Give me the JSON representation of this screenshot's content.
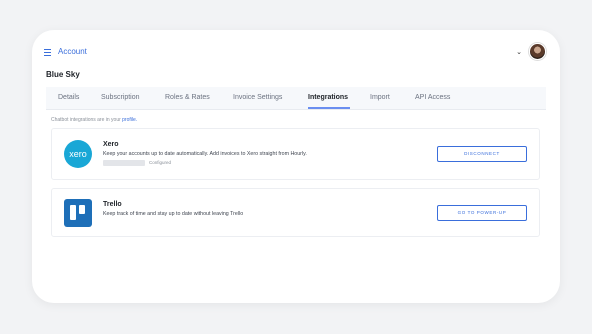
{
  "header": {
    "section_title": "Account",
    "company_name": "Blue Sky"
  },
  "tabs": [
    {
      "label": "Details"
    },
    {
      "label": "Subscription"
    },
    {
      "label": "Roles & Rates"
    },
    {
      "label": "Invoice Settings"
    },
    {
      "label": "Integrations",
      "active": true
    },
    {
      "label": "Import"
    },
    {
      "label": "API Access"
    }
  ],
  "note": {
    "prefix": "Chatbot integrations are in your",
    "link": "profile."
  },
  "integrations": [
    {
      "name": "Xero",
      "logo_text": "xero",
      "description": "Keep your accounts up to date automatically. Add invoices to Xero straight from Hourly.",
      "status": "Configured",
      "button_label": "DISCONNECT"
    },
    {
      "name": "Trello",
      "description": "Keep track of time and stay up to date without leaving Trello",
      "button_label": "GO TO POWER-UP"
    }
  ],
  "colors": {
    "accent": "#3a6edb",
    "xero": "#19a7d6",
    "trello": "#1e6fb8"
  }
}
